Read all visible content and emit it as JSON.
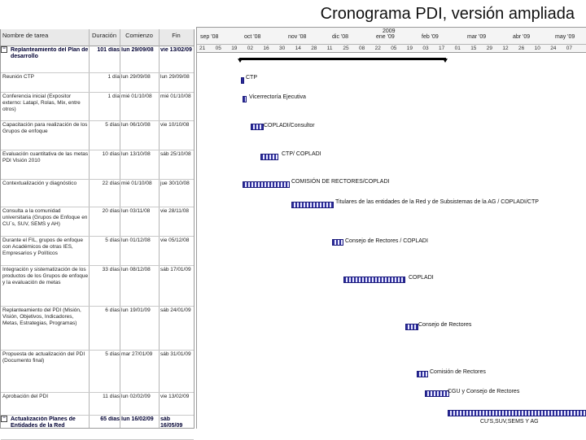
{
  "title": "Cronograma PDI, versión ampliada",
  "table": {
    "headers": {
      "name": "Nombre de tarea",
      "duration": "Duración",
      "start": "Comienzo",
      "end": "Fin"
    },
    "rows": [
      {
        "name": "Replanteamiento del Plan de desarrollo",
        "duration": "101 días",
        "start": "lun 29/09/08",
        "end": "vie 13/02/09",
        "summary": true
      },
      {
        "name": "Reunión CTP",
        "duration": "1 día",
        "start": "lun 29/09/08",
        "end": "lun 29/09/08"
      },
      {
        "name": "Conferencia inicial (Expositor externo: Latapí, Rolas, Mix, entre otros)",
        "duration": "1 día",
        "start": "mié 01/10/08",
        "end": "mié 01/10/08"
      },
      {
        "name": "Capacitación para realización de los Grupos de enfoque",
        "duration": "5 días",
        "start": "lun 06/10/08",
        "end": "vie 10/10/08"
      },
      {
        "name": "Evaluación cuantitativa de las metas PDI Visión 2010",
        "duration": "10 días",
        "start": "lun 13/10/08",
        "end": "sáb 25/10/08"
      },
      {
        "name": "Contextualización y diagnóstico",
        "duration": "22 días",
        "start": "mié 01/10/08",
        "end": "jue 30/10/08"
      },
      {
        "name": "Consulta a la comunidad universitaria (Grupos de Enfoque en CU´s, SUV, SEMS y AH)",
        "duration": "20 días",
        "start": "lun 03/11/08",
        "end": "vie 28/11/08"
      },
      {
        "name": "Durante el FIL, grupos de enfoque con Académicos de otras IES, Empresarios y Políticos",
        "duration": "5 días",
        "start": "lun 01/12/08",
        "end": "vie 05/12/08"
      },
      {
        "name": "Integración y sistematización de los productos de los Grupos de enfoque y la evaluación de metas",
        "duration": "33 días",
        "start": "lun 08/12/08",
        "end": "sáb 17/01/09"
      },
      {
        "name": "Replanteamiento del PDI (Misión, Visión, Objetivos, Indicadores, Metas, Estrategias, Programas)",
        "duration": "6 días",
        "start": "lun 19/01/09",
        "end": "sáb 24/01/09"
      },
      {
        "name": "Propuesta de actualización del PDI (Documento final)",
        "duration": "5 días",
        "start": "mar 27/01/09",
        "end": "sáb 31/01/09"
      },
      {
        "name": "Aprobación del PDI",
        "duration": "11 días",
        "start": "lun 02/02/09",
        "end": "vie 13/02/09"
      },
      {
        "name": "Actualización Planes de Entidades de la Red",
        "duration": "65 días",
        "start": "lun 16/02/09",
        "end": "sáb 16/05/09",
        "summary": true
      }
    ]
  },
  "timeline": {
    "years": [
      "2009"
    ],
    "months": [
      "sep '08",
      "oct '08",
      "nov '08",
      "dic '08",
      "ene '09",
      "feb '09",
      "mar '09",
      "abr '09",
      "may '09"
    ],
    "days": [
      "21",
      "05",
      "19",
      "02",
      "16",
      "30",
      "14",
      "28",
      "11",
      "25",
      "08",
      "22",
      "05",
      "19",
      "03",
      "17",
      "01",
      "15",
      "29",
      "12",
      "26",
      "10",
      "24",
      "07"
    ],
    "bars": [
      {
        "label": "CTP"
      },
      {
        "label": "Vicerrectoría Ejecutiva"
      },
      {
        "label": "COPLADI/Consultor"
      },
      {
        "label": "CTP/ COPLADI"
      },
      {
        "label": "COMISIÓN DE RECTORES/COPLADI"
      },
      {
        "label": "Titulares de las entidades de la Red y de Subsistemas de la AG / COPLADI/CTP"
      },
      {
        "label": "Consejo de Rectores / COPLADI"
      },
      {
        "label": "COPLADI"
      },
      {
        "label": "Consejo de Rectores"
      },
      {
        "label": "Comisión de Rectores"
      },
      {
        "label": "CGU y Consejo de Rectores"
      },
      {
        "label": "CU'S,SUV,SEMS Y AG"
      }
    ]
  }
}
